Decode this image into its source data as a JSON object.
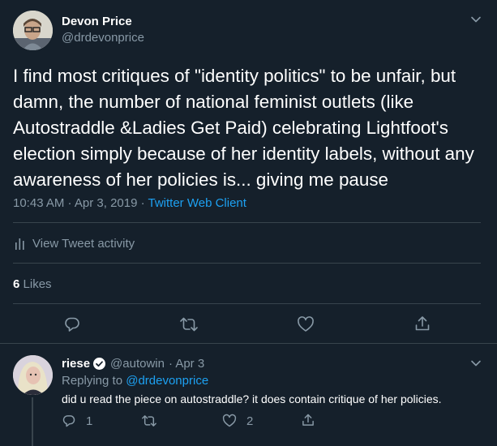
{
  "main_tweet": {
    "author_name": "Devon Price",
    "author_handle": "@drdevonprice",
    "text": "I find most critiques of \"identity politics\" to be unfair, but damn, the number of national feminist outlets (like Autostraddle &Ladies Get Paid) celebrating Lightfoot's election simply because of her identity labels, without any awareness of her policies is... giving me pause",
    "timestamp": "10:43 AM · Apr 3, 2019",
    "separator": " · ",
    "client": "Twitter Web Client",
    "activity_label": "View Tweet activity",
    "likes_count": "6",
    "likes_label": "Likes"
  },
  "reply": {
    "author_name": "riese",
    "author_handle": "@autowin",
    "date": "· Apr 3",
    "replying_prefix": "Replying to",
    "replying_handle": "@drdevonprice",
    "text": "did u read the piece on autostraddle? it does contain critique of her policies.",
    "reply_count": "1",
    "like_count": "2"
  },
  "colors": {
    "background": "#15202b",
    "divider": "#38444d",
    "muted": "#8899a6",
    "link": "#1da1f2"
  },
  "icons": [
    "chevron-down-icon",
    "bar-chart-icon",
    "reply-icon",
    "retweet-icon",
    "heart-icon",
    "share-icon",
    "verified-icon"
  ]
}
